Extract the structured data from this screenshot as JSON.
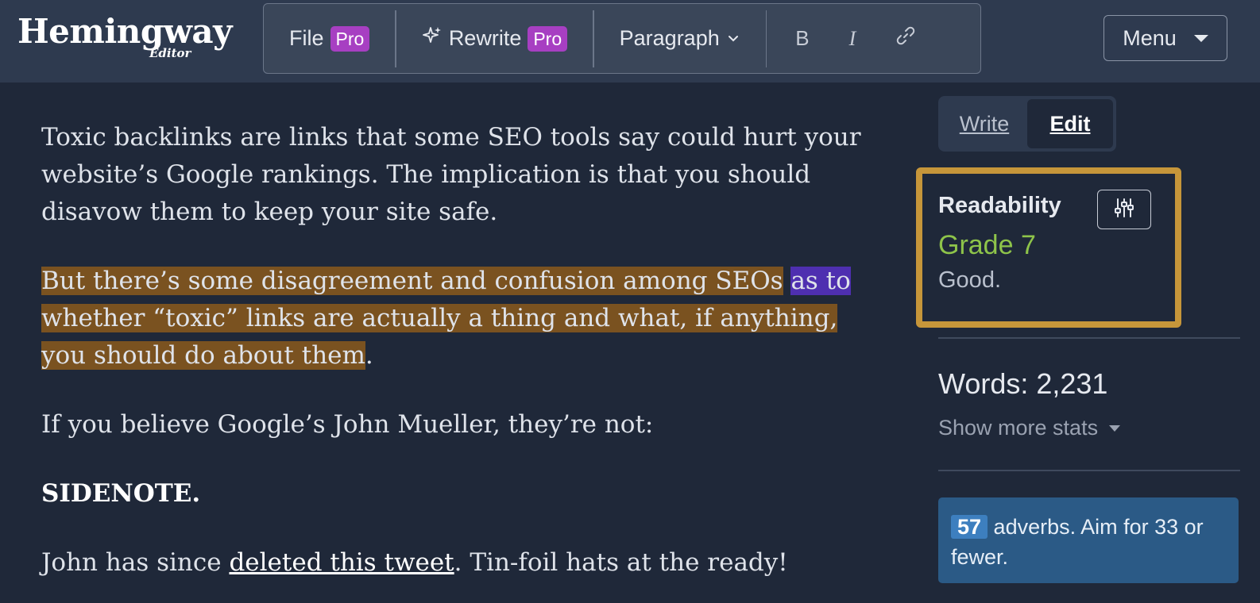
{
  "logo": {
    "main": "Hemingway",
    "sub": "Editor"
  },
  "toolbar": {
    "file_label": "File",
    "rewrite_label": "Rewrite",
    "pro_badge": "Pro",
    "paragraph_label": "Paragraph",
    "bold_label": "B",
    "italic_label": "I"
  },
  "menu": {
    "label": "Menu"
  },
  "editor": {
    "p1": "Toxic backlinks are links that some SEO tools say could hurt your website’s Google rankings. The implication is that you should disavow them to keep your site safe.",
    "p2_hard_1": "But there’s some disagreement and confusion among SEOs",
    "p2_space": " ",
    "p2_adverb": "as to",
    "p2_hard_2": "whether “toxic” links are actually a thing and what, if anything, you should do about them",
    "p2_end": ".",
    "p3": "If you believe Google’s John Mueller, they’re not:",
    "p4": "SIDENOTE.",
    "p5_start": "John has since ",
    "p5_link": "deleted this tweet",
    "p5_end": ". Tin-foil hats at the ready!"
  },
  "modes": {
    "write": "Write",
    "edit": "Edit",
    "active": "Edit"
  },
  "readability": {
    "title": "Readability",
    "grade": "Grade 7",
    "description": "Good."
  },
  "stats": {
    "words": "Words: 2,231",
    "more": "Show more stats"
  },
  "adverbs": {
    "count": "57",
    "message": " adverbs. Aim for 33 or fewer."
  },
  "colors": {
    "background": "#1f2839",
    "topbar": "#2e3a4f",
    "pro_badge": "#a73fc2",
    "hard_sentence": "#7a5220",
    "adverb": "#4e2fb0",
    "readability_border": "#c6963a",
    "grade_good": "#8ec44a",
    "adverb_box": "#2b5a86"
  },
  "icons": [
    "sparkle-icon",
    "chevron-down-icon",
    "link-icon",
    "sliders-icon",
    "caret-down-icon"
  ]
}
